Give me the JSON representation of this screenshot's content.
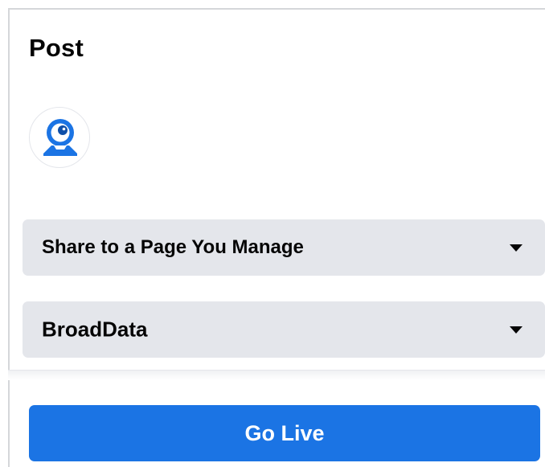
{
  "post": {
    "title": "Post"
  },
  "avatar": {
    "icon": "webcam-user-icon",
    "colors": {
      "primary": "#1b74e4",
      "dark": "#0f4fa8"
    }
  },
  "share_select": {
    "value": "Share to a Page You Manage",
    "icon": "caret-down-icon"
  },
  "page_select": {
    "value": "BroadData",
    "icon": "caret-down-icon"
  },
  "go_live_button": {
    "label": "Go Live",
    "color": "#1b74e4"
  }
}
